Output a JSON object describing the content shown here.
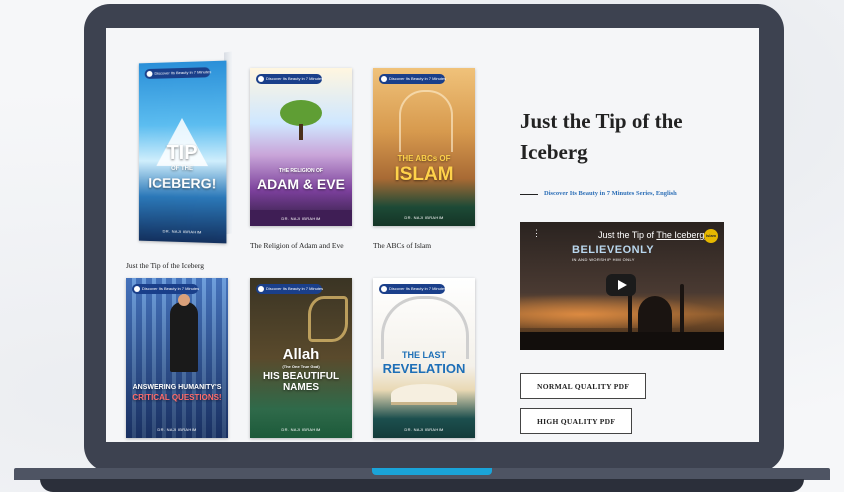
{
  "books": [
    {
      "id": "iceberg",
      "title_line1": "TIP",
      "title_line2": "ICEBERG!",
      "small_text": "OF THE",
      "caption": "Just the Tip of the Iceberg",
      "author": "DR. NAJI IBRAHIM"
    },
    {
      "id": "adam",
      "title_line1": "THE RELIGION OF",
      "title_line2": "ADAM & EVE",
      "caption": "The Religion of Adam and Eve",
      "author": "DR. NAJI IBRAHIM"
    },
    {
      "id": "abcs",
      "title_line1": "THE ABCs OF",
      "title_line2": "ISLAM",
      "caption": "The ABCs of Islam",
      "author": "DR. NAJI IBRAHIM"
    },
    {
      "id": "answering",
      "title_line1": "ANSWERING HUMANITY'S",
      "title_line2": "CRITICAL QUESTIONS!",
      "author": "DR. NAJI IBRAHIM"
    },
    {
      "id": "allah",
      "title_line1": "Allah",
      "small_text": "(The One True God)",
      "title_line2": "HIS BEAUTIFUL NAMES",
      "author": "DR. NAJI IBRAHIM"
    },
    {
      "id": "revelation",
      "title_line1": "THE LAST",
      "title_line2": "REVELATION",
      "author": "DR. NAJI IBRAHIM"
    }
  ],
  "badge_text": "Discover Its Beauty in 7 Minutes",
  "detail": {
    "title": "Just the Tip of the Iceberg",
    "series": "Discover Its Beauty in 7 Minutes Series, English"
  },
  "video": {
    "title_prefix": "Just the Tip of ",
    "title_link": "The Iceberg",
    "banner": "BELIEVEONLY",
    "subtitle": "IN AND WORSHIP HIM ONLY",
    "logo": "Islam"
  },
  "buttons": {
    "normal": "NORMAL QUALITY PDF",
    "high": "HIGH QUALITY PDF"
  },
  "colors": {
    "lid": "#3d4250",
    "accent": "#1aa4d9",
    "series_link": "#2d6fb7"
  }
}
